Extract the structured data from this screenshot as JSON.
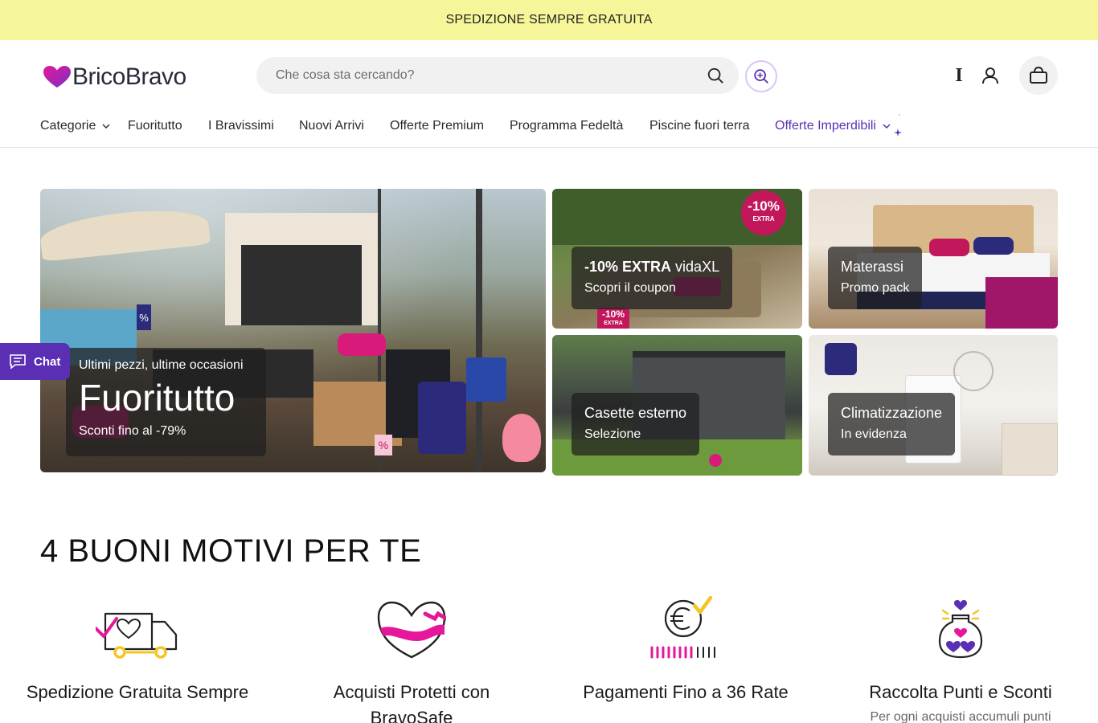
{
  "announcement": "SPEDIZIONE SEMPRE GRATUITA",
  "logo": {
    "text": "BricoBravo",
    "heart_color": "#c02aa4"
  },
  "search": {
    "placeholder": "Che cosa sta cercando?"
  },
  "header": {
    "wishlist_glyph": "I",
    "icons": [
      "search-icon",
      "visual-search-icon",
      "account-icon",
      "cart-icon"
    ]
  },
  "nav": {
    "items": [
      {
        "label": "Categorie",
        "dropdown": true
      },
      {
        "label": "Fuoritutto"
      },
      {
        "label": "I Bravissimi"
      },
      {
        "label": "Nuovi Arrivi"
      },
      {
        "label": "Offerte Premium"
      },
      {
        "label": "Programma Fedeltà"
      },
      {
        "label": "Piscine fuori terra"
      },
      {
        "label": "Offerte Imperdibili",
        "dropdown": true,
        "highlight": true
      }
    ],
    "highlight_color": "#5b2fb4"
  },
  "hero": {
    "main": {
      "pre": "Ultimi pezzi, ultime occasioni",
      "title": "Fuoritutto",
      "sub": "Sconti fino al -79%"
    },
    "tiles": [
      {
        "title_bold": "-10% EXTRA",
        "title_rest": "vidaXL",
        "sub": "Scopri il coupon",
        "badge_main": "-10%",
        "badge_sub": "EXTRA"
      },
      {
        "title": "Materassi",
        "sub": "Promo pack"
      },
      {
        "title": "Casette esterno",
        "sub": "Selezione"
      },
      {
        "title": "Climatizzazione",
        "sub": "In evidenza"
      }
    ],
    "decor_tag": "%",
    "decor_tag_2": "%"
  },
  "chat": {
    "label": "Chat"
  },
  "reasons": {
    "title": "4 BUONI MOTIVI PER TE",
    "items": [
      {
        "title": "Spedizione Gratuita Sempre",
        "icon": "truck-icon"
      },
      {
        "title": "Acquisti Protetti con BravoSafe",
        "icon": "shield-heart-icon"
      },
      {
        "title": "Pagamenti Fino a 36 Rate",
        "icon": "euro-installments-icon"
      },
      {
        "title": "Raccolta Punti e Sconti",
        "desc": "Per ogni acquisti accumuli punti",
        "icon": "points-jar-icon"
      }
    ]
  },
  "colors": {
    "accent": "#5b2fb4",
    "brand_pink": "#e5179a",
    "announce_bg": "#f5f59a",
    "yellow": "#f3c623"
  }
}
